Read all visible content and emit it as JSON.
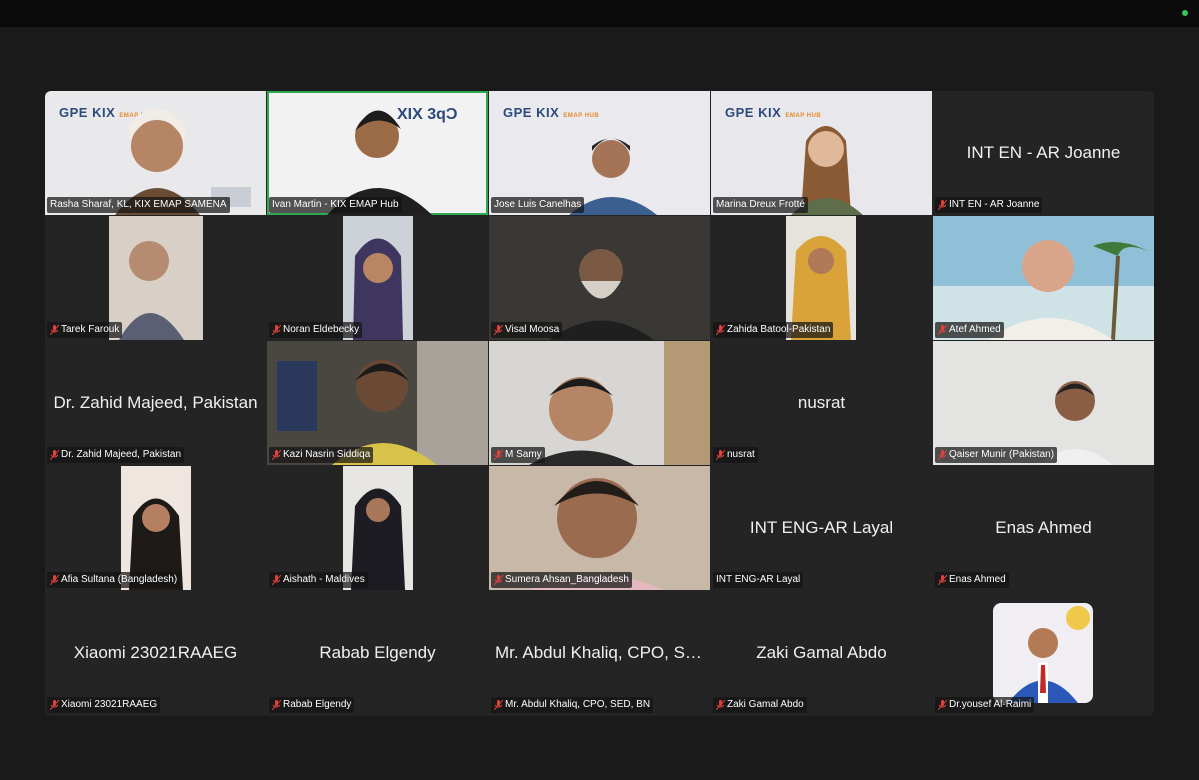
{
  "meeting": {
    "participants": [
      {
        "name": "Rasha Sharaf, KL, KIX EMAP SAMENA",
        "video": true,
        "muted": false,
        "active": false
      },
      {
        "name": "Ivan Martin - KIX EMAP Hub",
        "video": true,
        "muted": false,
        "active": true
      },
      {
        "name": "Jose Luis Canelhas",
        "video": true,
        "muted": false,
        "active": false
      },
      {
        "name": "Marina Dreux Frotté",
        "video": true,
        "muted": false,
        "active": false
      },
      {
        "name": "INT EN - AR Joanne",
        "display": "INT EN - AR Joanne",
        "video": false,
        "muted": true
      },
      {
        "name": "Tarek Farouk",
        "video": true,
        "muted": true
      },
      {
        "name": "Noran Eldebecky",
        "video": true,
        "muted": true
      },
      {
        "name": "Visal Moosa",
        "video": true,
        "muted": true
      },
      {
        "name": "Zahida Batool-Pakistan",
        "video": true,
        "muted": true
      },
      {
        "name": "Atef Ahmed",
        "video": true,
        "muted": true
      },
      {
        "name": "Dr. Zahid Majeed, Pakistan",
        "display": "Dr. Zahid Majeed, Pakistan",
        "video": false,
        "muted": true
      },
      {
        "name": "Kazi Nasrin Siddiqa",
        "video": true,
        "muted": true
      },
      {
        "name": "M Samy",
        "video": true,
        "muted": true
      },
      {
        "name": "nusrat",
        "display": "nusrat",
        "video": false,
        "muted": true
      },
      {
        "name": "Qaiser Munir (Pakistan)",
        "video": true,
        "muted": true
      },
      {
        "name": "Afia Sultana (Bangladesh)",
        "video": true,
        "muted": true
      },
      {
        "name": "Aishath - Maldives",
        "video": true,
        "muted": true
      },
      {
        "name": "Sumera Ahsan_Bangladesh",
        "video": true,
        "muted": true
      },
      {
        "name": "INT ENG-AR Layal",
        "display": "INT ENG-AR Layal",
        "video": false,
        "muted": false
      },
      {
        "name": "Enas Ahmed",
        "display": "Enas Ahmed",
        "video": false,
        "muted": true
      },
      {
        "name": "Xiaomi 23021RAAEG",
        "display": "Xiaomi 23021RAAEG",
        "video": false,
        "muted": true
      },
      {
        "name": "Rabab Elgendy",
        "display": "Rabab Elgendy",
        "video": false,
        "muted": true
      },
      {
        "name": "Mr. Abdul Khaliq, CPO, SED, BN",
        "display": "Mr. Abdul Khaliq, CPO, SE...",
        "video": false,
        "muted": true
      },
      {
        "name": "Zaki Gamal Abdo",
        "display": "Zaki Gamal Abdo",
        "video": false,
        "muted": true
      },
      {
        "name": "Dr.yousef Al-Raimi",
        "video": true,
        "muted": true
      }
    ]
  },
  "colors": {
    "active_border": "#2fa84f",
    "muted_mic": "#e0413a",
    "record_dot": "#35c759"
  },
  "brand_logo": {
    "main": "GPE KIX",
    "sub": "EMAP HUB"
  }
}
